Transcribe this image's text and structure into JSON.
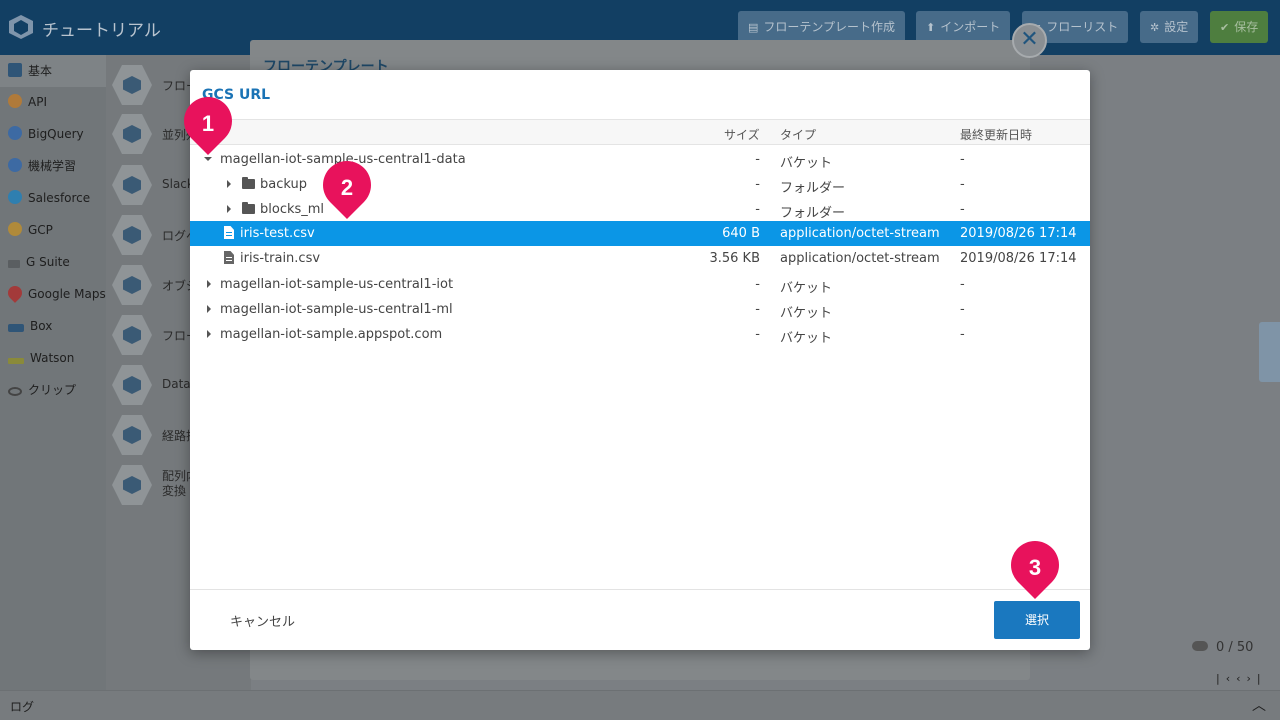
{
  "app": {
    "title": "チュートリアル",
    "toolbar": {
      "template_create": "フローテンプレート作成",
      "import": "インポート",
      "flow_list": "フローリスト",
      "settings": "設定",
      "save": "保存"
    }
  },
  "sidebar": {
    "items": [
      {
        "label": "基本",
        "icon": "basic-icon"
      },
      {
        "label": "API",
        "icon": "api-icon"
      },
      {
        "label": "BigQuery",
        "icon": "bigquery-icon"
      },
      {
        "label": "機械学習",
        "icon": "machine-learning-icon"
      },
      {
        "label": "Salesforce",
        "icon": "salesforce-icon"
      },
      {
        "label": "GCP",
        "icon": "gcp-icon"
      },
      {
        "label": "G Suite",
        "icon": "gsuite-icon"
      },
      {
        "label": "Google Maps",
        "icon": "google-maps-icon"
      },
      {
        "label": "Box",
        "icon": "box-icon"
      },
      {
        "label": "Watson",
        "icon": "watson-icon"
      },
      {
        "label": "クリップ",
        "icon": "clip-icon"
      }
    ]
  },
  "palette": {
    "items": [
      {
        "label": "フロー"
      },
      {
        "label": "並列処"
      },
      {
        "label": "Slack"
      },
      {
        "label": "ログへ"
      },
      {
        "label": "オブジ"
      },
      {
        "label": "フロー"
      },
      {
        "label": "Data"
      },
      {
        "label": "経路探"
      },
      {
        "label": "配列内 変換"
      }
    ]
  },
  "background": {
    "panel_title": "フローテンプレート",
    "counter": "0 / 50",
    "log_label": "ログ"
  },
  "modal": {
    "title": "GCS URL",
    "columns": {
      "size": "サイズ",
      "type": "タイプ",
      "modified": "最終更新日時"
    },
    "rows": [
      {
        "name": "magellan-iot-sample-us-central1-data",
        "size": "-",
        "type": "バケット",
        "modified": "-",
        "kind": "bucket",
        "expanded": true
      },
      {
        "name": "backup",
        "size": "-",
        "type": "フォルダー",
        "modified": "-",
        "kind": "folder"
      },
      {
        "name": "blocks_ml",
        "size": "-",
        "type": "フォルダー",
        "modified": "-",
        "kind": "folder"
      },
      {
        "name": "iris-test.csv",
        "size": "640 B",
        "type": "application/octet-stream",
        "modified": "2019/08/26 17:14",
        "kind": "file",
        "selected": true
      },
      {
        "name": "iris-train.csv",
        "size": "3.56 KB",
        "type": "application/octet-stream",
        "modified": "2019/08/26 17:14",
        "kind": "file"
      },
      {
        "name": "magellan-iot-sample-us-central1-iot",
        "size": "-",
        "type": "バケット",
        "modified": "-",
        "kind": "bucket"
      },
      {
        "name": "magellan-iot-sample-us-central1-ml",
        "size": "-",
        "type": "バケット",
        "modified": "-",
        "kind": "bucket"
      },
      {
        "name": "magellan-iot-sample.appspot.com",
        "size": "-",
        "type": "バケット",
        "modified": "-",
        "kind": "bucket"
      }
    ],
    "cancel_label": "キャンセル",
    "select_label": "選択"
  },
  "callouts": [
    "1",
    "2",
    "3"
  ],
  "colors": {
    "accent": "#1a78bf",
    "selected_row": "#0b96e6",
    "callout": "#e8125c"
  }
}
